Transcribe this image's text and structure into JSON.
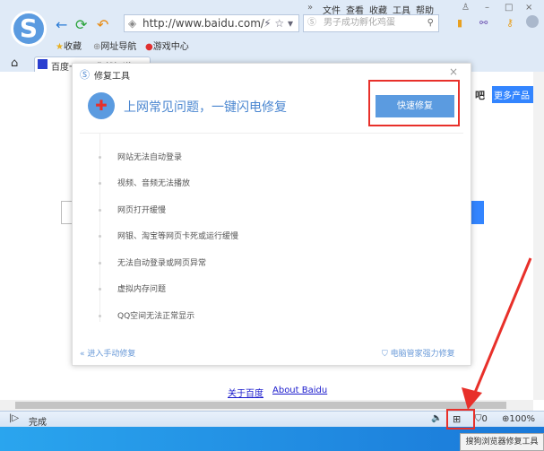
{
  "menu": [
    "文件",
    "查看",
    "收藏",
    "工具",
    "帮助"
  ],
  "address": {
    "url": "http://www.baidu.com/"
  },
  "search": {
    "placeholder": "男子成功孵化鸡蛋"
  },
  "favbar": [
    "收藏",
    "网址导航",
    "游戏中心"
  ],
  "tab": {
    "title": "百度一下，你就知道"
  },
  "page": {
    "partial_text": "吧",
    "more_products": "更多产品",
    "footer_links": [
      "关于百度",
      "About Baidu"
    ]
  },
  "dialog": {
    "title": "修复工具",
    "headline": "上网常见问题，一键闪电修复",
    "quick_fix": "快速修复",
    "items": [
      "网站无法自动登录",
      "视频、音频无法播放",
      "网页打开缓慢",
      "网银、淘宝等网页卡死或运行缓慢",
      "无法自动登录或网页异常",
      "虚拟内存问题",
      "QQ空间无法正常显示"
    ],
    "manual": "进入手动修复",
    "guard": "电脑管家强力修复"
  },
  "status": {
    "text": "完成",
    "shield_count": "0",
    "zoom": "100%",
    "tooltip": "搜狗浏览器修复工具"
  },
  "colors": {
    "accent": "#5b9be0",
    "highlight": "#e8302a"
  }
}
